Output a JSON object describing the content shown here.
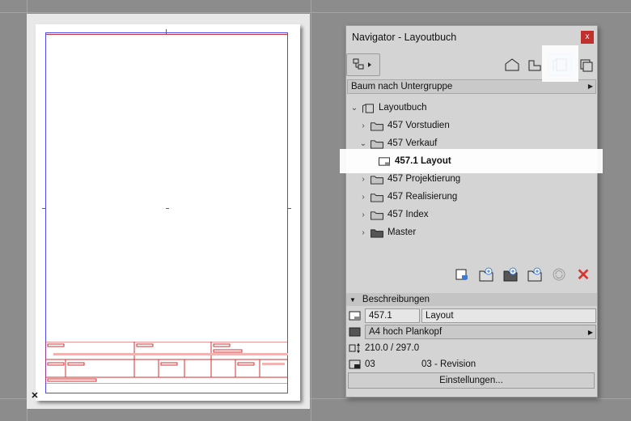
{
  "navigator": {
    "title": "Navigator - Layoutbuch",
    "close_label": "x",
    "view_mode": "Baum nach Untergruppe",
    "tree": {
      "root": "Layoutbuch",
      "items": [
        {
          "label": "457 Vorstudien",
          "expanded": false
        },
        {
          "label": "457 Verkauf",
          "expanded": true
        },
        {
          "label": "457.1 Layout",
          "selected": true
        },
        {
          "label": "457 Projektierung",
          "expanded": false
        },
        {
          "label": "457 Realisierung",
          "expanded": false
        },
        {
          "label": "457 Index",
          "expanded": false
        },
        {
          "label": "Master",
          "expanded": false
        }
      ]
    },
    "descriptions": {
      "header": "Beschreibungen",
      "id_value": "457.1",
      "name_value": "Layout",
      "master_value": "A4 hoch Plankopf",
      "size_value": "210.0 / 297.0",
      "revision_number": "03",
      "revision_label": "03 - Revision",
      "settings_label": "Einstellungen..."
    }
  },
  "colors": {
    "accent_blue": "#4b4bf0",
    "red_lines": "#d23232",
    "delete_red": "#d8362e",
    "highlight": "#b6d5ef"
  }
}
